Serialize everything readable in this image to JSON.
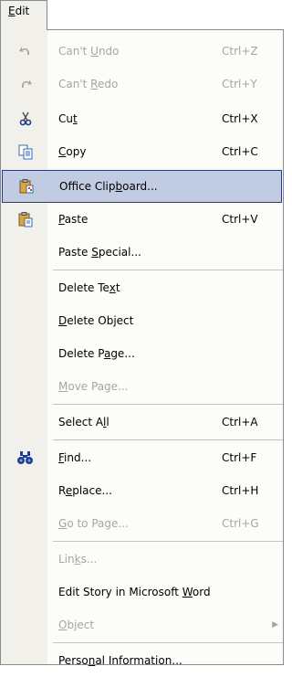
{
  "menubar": {
    "edit_pre": "",
    "edit_acc": "E",
    "edit_post": "dit"
  },
  "menu": {
    "undo": {
      "pre": "Can't ",
      "acc": "U",
      "post": "ndo",
      "shortcut": "Ctrl+Z",
      "icon": "undo-icon"
    },
    "redo": {
      "pre": "Can't ",
      "acc": "R",
      "post": "edo",
      "shortcut": "Ctrl+Y",
      "icon": "redo-icon"
    },
    "cut": {
      "pre": "Cu",
      "acc": "t",
      "post": "",
      "shortcut": "Ctrl+X",
      "icon": "scissors-icon"
    },
    "copy": {
      "pre": "",
      "acc": "C",
      "post": "opy",
      "shortcut": "Ctrl+C",
      "icon": "copy-icon"
    },
    "clipboard": {
      "pre": "Office Clip",
      "acc": "b",
      "post": "oard...",
      "icon": "clipboard-icon"
    },
    "paste": {
      "pre": "",
      "acc": "P",
      "post": "aste",
      "shortcut": "Ctrl+V",
      "icon": "paste-icon"
    },
    "paste_special": {
      "pre": "Paste ",
      "acc": "S",
      "post": "pecial..."
    },
    "delete_text": {
      "pre": "Delete Te",
      "acc": "x",
      "post": "t"
    },
    "delete_object": {
      "pre": "",
      "acc": "D",
      "post": "elete Object"
    },
    "delete_page": {
      "pre": "Delete P",
      "acc": "a",
      "post": "ge..."
    },
    "move_page": {
      "pre": "",
      "acc": "M",
      "post": "ove Page..."
    },
    "select_all": {
      "pre": "Select A",
      "acc": "l",
      "post": "l",
      "shortcut": "Ctrl+A"
    },
    "find": {
      "pre": "",
      "acc": "F",
      "post": "ind...",
      "shortcut": "Ctrl+F",
      "icon": "binoculars-icon"
    },
    "replace": {
      "pre": "R",
      "acc": "e",
      "post": "place...",
      "shortcut": "Ctrl+H"
    },
    "goto": {
      "pre": "",
      "acc": "G",
      "post": "o to Page...",
      "shortcut": "Ctrl+G"
    },
    "links": {
      "pre": "Lin",
      "acc": "k",
      "post": "s..."
    },
    "edit_story": {
      "pre": "Edit Story in Microsoft ",
      "acc": "W",
      "post": "ord"
    },
    "object": {
      "pre": "",
      "acc": "O",
      "post": "bject"
    },
    "personal_info": {
      "pre": "Perso",
      "acc": "n",
      "post": "al Information..."
    }
  }
}
